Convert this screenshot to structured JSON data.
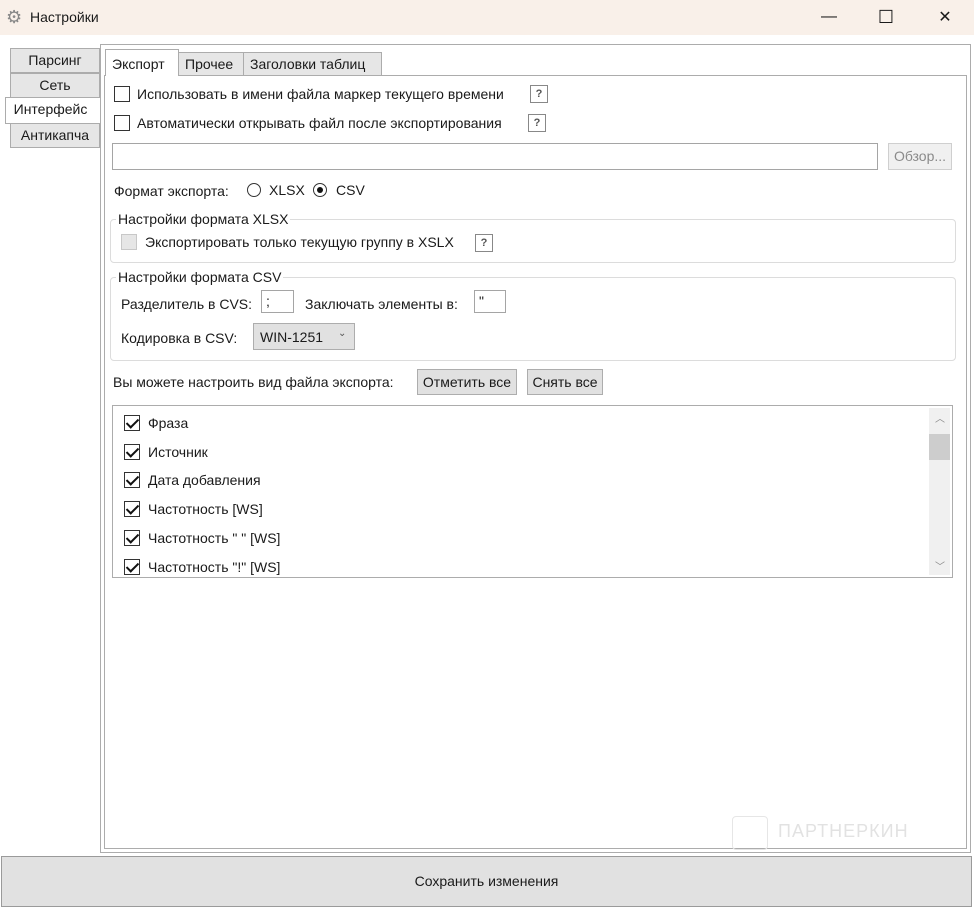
{
  "window": {
    "title": "Настройки",
    "minimize": "—",
    "maximize": "☐",
    "close": "✕"
  },
  "side_tabs": [
    {
      "label": "Парсинг"
    },
    {
      "label": "Сеть"
    },
    {
      "label": "Интерфейс"
    },
    {
      "label": "Антикапча"
    }
  ],
  "tabs": [
    {
      "label": "Экспорт"
    },
    {
      "label": "Прочее"
    },
    {
      "label": "Заголовки таблиц"
    }
  ],
  "export": {
    "use_time_marker": {
      "label": "Использовать в имени файла маркер текущего времени",
      "checked": false,
      "help": "?"
    },
    "auto_open": {
      "label": "Автоматически открывать файл после экспортирования",
      "checked": false,
      "help": "?"
    },
    "path_value": "",
    "browse_label": "Обзор...",
    "format_label": "Формат экспорта:",
    "format_options": [
      "XLSX",
      "CSV"
    ],
    "format_selected": "CSV",
    "xlsx_group": {
      "legend": "Настройки формата XLSX",
      "only_current_group": {
        "label": "Экспортировать только текущую группу в XSLX",
        "checked": false,
        "help": "?"
      }
    },
    "csv_group": {
      "legend": "Настройки формата CSV",
      "separator_label": "Разделитель в CVS:",
      "separator_value": ";",
      "enclose_label": "Заключать элементы в:",
      "enclose_value": "\"",
      "encoding_label": "Кодировка в CSV:",
      "encoding_value": "WIN-1251"
    },
    "customize_label": "Вы можете настроить вид файла экспорта:",
    "check_all": "Отметить все",
    "uncheck_all": "Снять все",
    "columns": [
      {
        "label": "Фраза",
        "checked": true
      },
      {
        "label": "Источник",
        "checked": true
      },
      {
        "label": "Дата добавления",
        "checked": true
      },
      {
        "label": "Частотность [WS]",
        "checked": true
      },
      {
        "label": "Частотность \" \" [WS]",
        "checked": true
      },
      {
        "label": "Частотность \"!\" [WS]",
        "checked": true
      }
    ]
  },
  "watermark": "ПАРТНЕРКИН",
  "save_label": "Сохранить изменения"
}
